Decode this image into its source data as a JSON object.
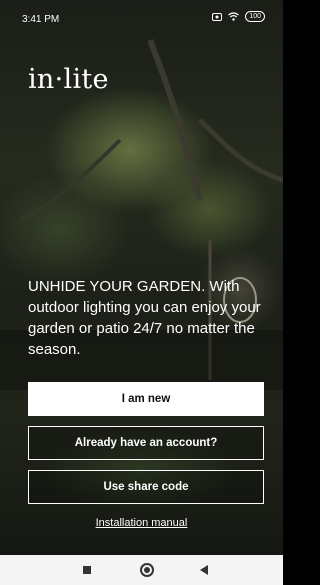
{
  "status_bar": {
    "time": "3:41 PM",
    "battery": "100"
  },
  "brand": {
    "logo_text": "in·lite"
  },
  "tagline": "UNHIDE YOUR GARDEN. With outdoor lighting you can enjoy your garden or patio 24/7 no matter the season.",
  "actions": {
    "new_label": "I am new",
    "account_label": "Already have an account?",
    "share_label": "Use share code"
  },
  "manual_link": "Installation manual",
  "nav_bar": {
    "icons": [
      "recent-apps-icon",
      "home-icon",
      "back-icon"
    ]
  },
  "colors": {
    "primary_button_bg": "#ffffff",
    "outline_button_border": "#ffffff",
    "nav_bar_bg": "#f4f4f4"
  }
}
